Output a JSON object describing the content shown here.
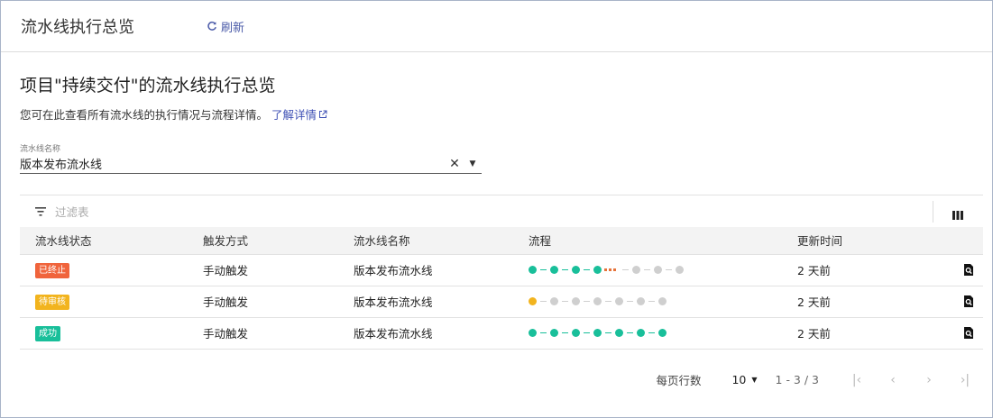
{
  "header": {
    "title": "流水线执行总览",
    "refresh_label": "刷新"
  },
  "main": {
    "heading": "项目\"持续交付\"的流水线执行总览",
    "description": "您可在此查看所有流水线的执行情况与流程详情。",
    "learn_more": "了解详情"
  },
  "filter_field": {
    "label": "流水线名称",
    "value": "版本发布流水线"
  },
  "table": {
    "filter_placeholder": "过滤表",
    "columns": [
      "流水线状态",
      "触发方式",
      "流水线名称",
      "流程",
      "更新时间"
    ],
    "rows": [
      {
        "status": "已终止",
        "status_color": "#f0643c",
        "trigger": "手动触发",
        "name": "版本发布流水线",
        "flow": [
          "success",
          "success",
          "success",
          "success",
          "stopped",
          "pending",
          "pending",
          "pending"
        ],
        "updated": "2 天前"
      },
      {
        "status": "待审核",
        "status_color": "#f2b41e",
        "trigger": "手动触发",
        "name": "版本发布流水线",
        "flow": [
          "waiting",
          "pending",
          "pending",
          "pending",
          "pending",
          "pending",
          "pending"
        ],
        "updated": "2 天前"
      },
      {
        "status": "成功",
        "status_color": "#19bf9a",
        "trigger": "手动触发",
        "name": "版本发布流水线",
        "flow": [
          "success",
          "success",
          "success",
          "success",
          "success",
          "success",
          "success"
        ],
        "updated": "2 天前"
      }
    ]
  },
  "pagination": {
    "rows_per_page_label": "每页行数",
    "rows_per_page": "10",
    "range": "1 - 3 / 3"
  },
  "colors": {
    "success": "#19bf9a",
    "waiting": "#f2b41e",
    "stopped": "#e6733a",
    "pending": "#cfcfcf",
    "link": "#3f51b5"
  }
}
